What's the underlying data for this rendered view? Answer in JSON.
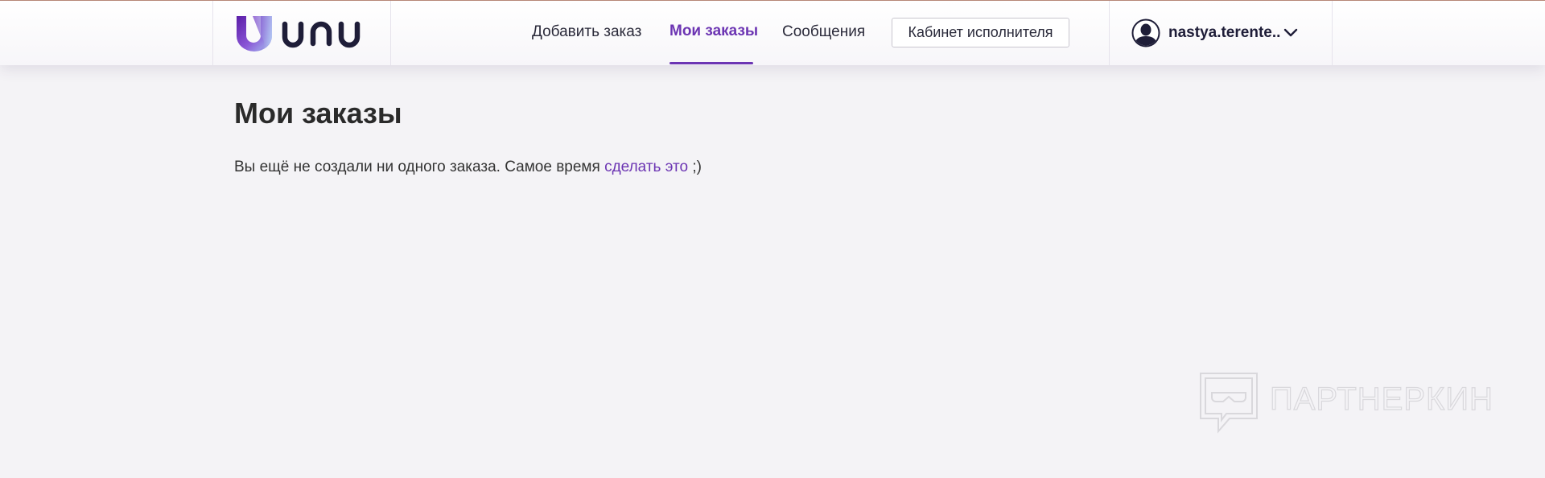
{
  "header": {
    "logo_text": "unu",
    "nav": [
      {
        "label": "Добавить заказ",
        "active": false
      },
      {
        "label": "Мои заказы",
        "active": true
      },
      {
        "label": "Сообщения",
        "active": false
      }
    ],
    "cabinet_button": "Кабинет исполнителя",
    "user": {
      "name": "nastya.terente..",
      "avatar_icon": "user-avatar-icon",
      "dropdown_icon": "chevron-down-icon"
    }
  },
  "main": {
    "title": "Мои заказы",
    "empty_message": {
      "before": "Вы ещё не создали ни одного заказа. Самое время ",
      "link": "сделать это",
      "after": " ;)"
    }
  },
  "watermark": {
    "text": "ПАРТНЕРКИН",
    "icon": "chat-bubble-mask-icon"
  },
  "colors": {
    "accent": "#6c35b3",
    "background": "#f4f3f6",
    "logo_dark": "#1e1d38"
  }
}
